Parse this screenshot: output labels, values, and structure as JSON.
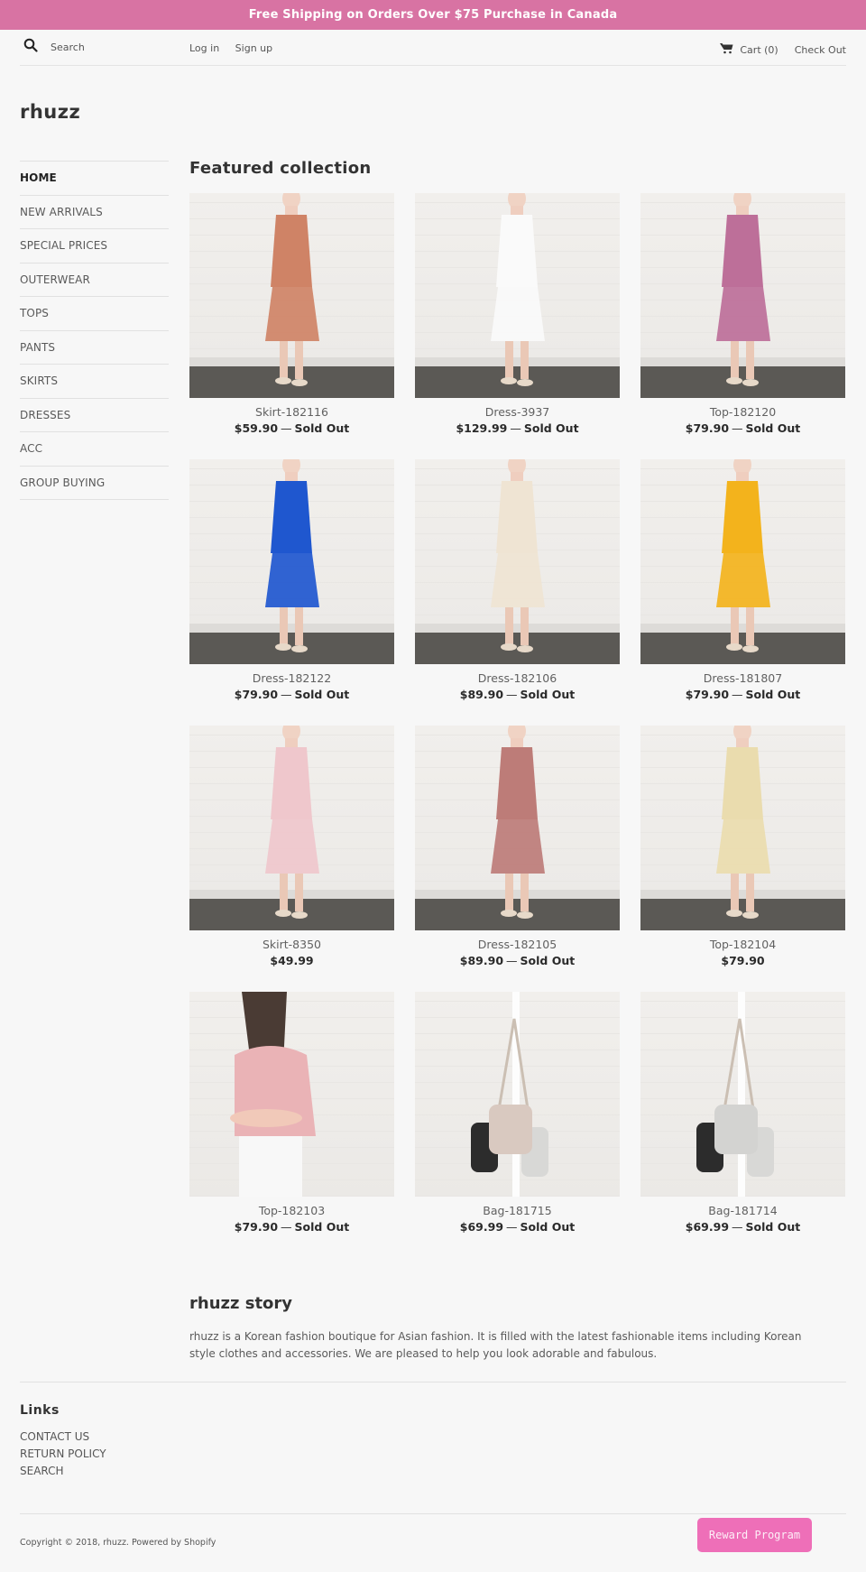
{
  "announcement": "Free Shipping on Orders Over $75 Purchase in Canada",
  "header": {
    "search_placeholder": "Search",
    "login": "Log in",
    "signup": "Sign up",
    "cart": "Cart (0)",
    "checkout": "Check Out",
    "logo": "rhuzz"
  },
  "sidebar": {
    "items": [
      {
        "label": "HOME",
        "active": true
      },
      {
        "label": "NEW ARRIVALS"
      },
      {
        "label": "SPECIAL PRICES"
      },
      {
        "label": "OUTERWEAR"
      },
      {
        "label": "TOPS"
      },
      {
        "label": "PANTS"
      },
      {
        "label": "SKIRTS"
      },
      {
        "label": "DRESSES"
      },
      {
        "label": "ACC"
      },
      {
        "label": "GROUP BUYING"
      }
    ]
  },
  "featured": {
    "title": "Featured collection",
    "sold_out_label": "Sold Out",
    "separator": "—",
    "products": [
      {
        "title": "Skirt-182116",
        "price": "$59.90",
        "sold_out": true,
        "image": "model-orange-skirt",
        "color": "#cf8366",
        "kind": "model"
      },
      {
        "title": "Dress-3937",
        "price": "$129.99",
        "sold_out": true,
        "image": "model-white-dress",
        "color": "#fafafa",
        "kind": "model"
      },
      {
        "title": "Top-182120",
        "price": "$79.90",
        "sold_out": true,
        "image": "model-mauve-top",
        "color": "#bd6f99",
        "kind": "model"
      },
      {
        "title": "Dress-182122",
        "price": "$79.90",
        "sold_out": true,
        "image": "model-blue-dress",
        "color": "#1f57cf",
        "kind": "model"
      },
      {
        "title": "Dress-182106",
        "price": "$89.90",
        "sold_out": true,
        "image": "model-floral-dress",
        "color": "#efe4d3",
        "kind": "model"
      },
      {
        "title": "Dress-181807",
        "price": "$79.90",
        "sold_out": true,
        "image": "model-yellow-dress",
        "color": "#f3b31c",
        "kind": "model"
      },
      {
        "title": "Skirt-8350",
        "price": "$49.99",
        "sold_out": false,
        "image": "model-white-skirt",
        "color": "#efc7cc",
        "kind": "model"
      },
      {
        "title": "Dress-182105",
        "price": "$89.90",
        "sold_out": true,
        "image": "model-rose-dress",
        "color": "#bd7c78",
        "kind": "model"
      },
      {
        "title": "Top-182104",
        "price": "$79.90",
        "sold_out": false,
        "image": "model-floral-top",
        "color": "#eadcae",
        "kind": "model"
      },
      {
        "title": "Top-182103",
        "price": "$79.90",
        "sold_out": true,
        "image": "model-pink-top",
        "color": "#eab3b6",
        "kind": "closeup"
      },
      {
        "title": "Bag-181715",
        "price": "$69.99",
        "sold_out": true,
        "image": "bags-on-stand-beige",
        "color": "#d9c9c0",
        "kind": "bag"
      },
      {
        "title": "Bag-181714",
        "price": "$69.99",
        "sold_out": true,
        "image": "bags-on-stand-grey",
        "color": "#d3d3d1",
        "kind": "bag"
      }
    ]
  },
  "story": {
    "title": "rhuzz story",
    "text": "rhuzz is a Korean fashion boutique for Asian fashion. It is filled with the latest fashionable items including Korean style clothes and accessories. We are pleased to help you look adorable and fabulous."
  },
  "footer": {
    "links_title": "Links",
    "links": [
      "CONTACT US",
      "RETURN POLICY",
      "SEARCH"
    ],
    "copyright": "Copyright © 2018, rhuzz. Powered by Shopify",
    "reward_button": "Reward Program"
  },
  "colors": {
    "announcement_bg": "#d873a3",
    "reward_bg": "#ee6fb8",
    "page_bg": "#f7f7f7"
  }
}
